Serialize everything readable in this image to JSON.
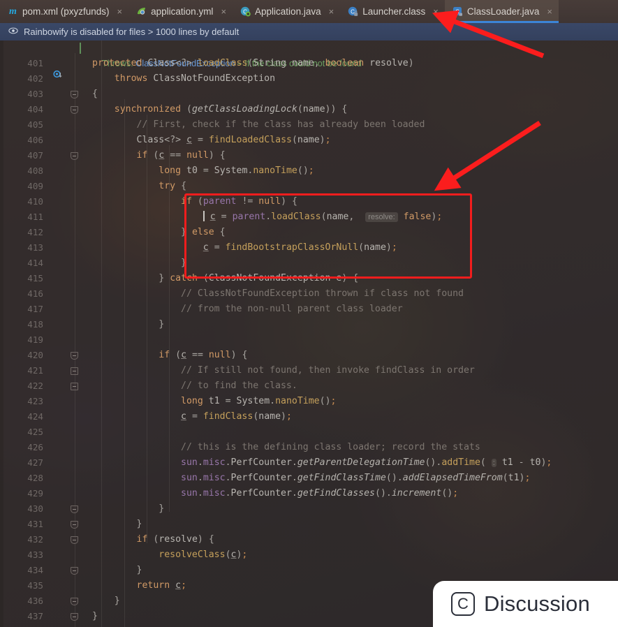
{
  "window": {
    "accent_blue": "#3c85d8",
    "annotation_red": "#f21d1d",
    "editor_bg": "#3b3331"
  },
  "tabs": [
    {
      "label": "pom.xml (pxyzfunds)",
      "icon": "maven-icon",
      "close": "×",
      "active": false
    },
    {
      "label": "application.yml",
      "icon": "spring-leaf-icon",
      "close": "×",
      "active": false
    },
    {
      "label": "Application.java",
      "icon": "java-class-spring-icon",
      "close": "×",
      "active": false
    },
    {
      "label": "Launcher.class",
      "icon": "java-class-locked-icon",
      "close": "×",
      "active": false
    },
    {
      "label": "ClassLoader.java",
      "icon": "java-class-readonly-icon",
      "close": "×",
      "active": true
    }
  ],
  "notification": {
    "icon": "eye-icon",
    "message": "Rainbowify is disabled for files > 1000 lines by default"
  },
  "doc_hint": {
    "prefix": "Throws:",
    "type": "ClassNotFoundException",
    "dash": "–",
    "text": "If the class could not be found"
  },
  "gutter": {
    "override_icon": "override-method-icon",
    "first_line": 401,
    "last_line": 437
  },
  "parameter_hint": {
    "label": "resolve:"
  },
  "code": {
    "lines": [
      {
        "n": 401,
        "fold": "",
        "text": "protected Class<?> loadClass(String name, boolean resolve)"
      },
      {
        "n": 402,
        "fold": "",
        "text": "    throws ClassNotFoundException"
      },
      {
        "n": 403,
        "fold": "arrow",
        "text": "{"
      },
      {
        "n": 404,
        "fold": "arrow",
        "text": "    synchronized (getClassLoadingLock(name)) {"
      },
      {
        "n": 405,
        "fold": "",
        "text": "        // First, check if the class has already been loaded"
      },
      {
        "n": 406,
        "fold": "",
        "text": "        Class<?> c = findLoadedClass(name);"
      },
      {
        "n": 407,
        "fold": "arrow",
        "text": "        if (c == null) {"
      },
      {
        "n": 408,
        "fold": "",
        "text": "            long t0 = System.nanoTime();"
      },
      {
        "n": 409,
        "fold": "",
        "text": "            try {"
      },
      {
        "n": 410,
        "fold": "",
        "text": "                if (parent != null) {"
      },
      {
        "n": 411,
        "fold": "",
        "text": "                    c = parent.loadClass(name,  resolve: false);"
      },
      {
        "n": 412,
        "fold": "",
        "text": "                } else {"
      },
      {
        "n": 413,
        "fold": "",
        "text": "                    c = findBootstrapClassOrNull(name);"
      },
      {
        "n": 414,
        "fold": "",
        "text": "                }"
      },
      {
        "n": 415,
        "fold": "",
        "text": "            } catch (ClassNotFoundException e) {"
      },
      {
        "n": 416,
        "fold": "",
        "text": "                // ClassNotFoundException thrown if class not found"
      },
      {
        "n": 417,
        "fold": "",
        "text": "                // from the non-null parent class loader"
      },
      {
        "n": 418,
        "fold": "",
        "text": "            }"
      },
      {
        "n": 419,
        "fold": "",
        "text": ""
      },
      {
        "n": 420,
        "fold": "arrow",
        "text": "            if (c == null) {"
      },
      {
        "n": 421,
        "fold": "bar",
        "text": "                // If still not found, then invoke findClass in order"
      },
      {
        "n": 422,
        "fold": "bar2",
        "text": "                // to find the class."
      },
      {
        "n": 423,
        "fold": "",
        "text": "                long t1 = System.nanoTime();"
      },
      {
        "n": 424,
        "fold": "",
        "text": "                c = findClass(name);"
      },
      {
        "n": 425,
        "fold": "",
        "text": ""
      },
      {
        "n": 426,
        "fold": "",
        "text": "                // this is the defining class loader; record the stats"
      },
      {
        "n": 427,
        "fold": "",
        "text": "                sun.misc.PerfCounter.getParentDelegationTime().addTime( : t1 - t0);"
      },
      {
        "n": 428,
        "fold": "",
        "text": "                sun.misc.PerfCounter.getFindClassTime().addElapsedTimeFrom(t1);"
      },
      {
        "n": 429,
        "fold": "",
        "text": "                sun.misc.PerfCounter.getFindClasses().increment();"
      },
      {
        "n": 430,
        "fold": "arrow",
        "text": "            }"
      },
      {
        "n": 431,
        "fold": "arrow",
        "text": "        }"
      },
      {
        "n": 432,
        "fold": "arrow",
        "text": "        if (resolve) {"
      },
      {
        "n": 433,
        "fold": "",
        "text": "            resolveClass(c);"
      },
      {
        "n": 434,
        "fold": "arrow",
        "text": "        }"
      },
      {
        "n": 435,
        "fold": "",
        "text": "        return c;"
      },
      {
        "n": 436,
        "fold": "arrow",
        "text": "    }"
      },
      {
        "n": 437,
        "fold": "arrow",
        "text": "}"
      }
    ]
  },
  "annotations": {
    "arrow_tab": "arrow-pointing-to-classloader-tab",
    "arrow_block": "arrow-pointing-to-highlighted-code",
    "highlight_box": "red-highlight-rectangle"
  },
  "watermark": {
    "icon_letter": "C",
    "label": "Discussion"
  }
}
